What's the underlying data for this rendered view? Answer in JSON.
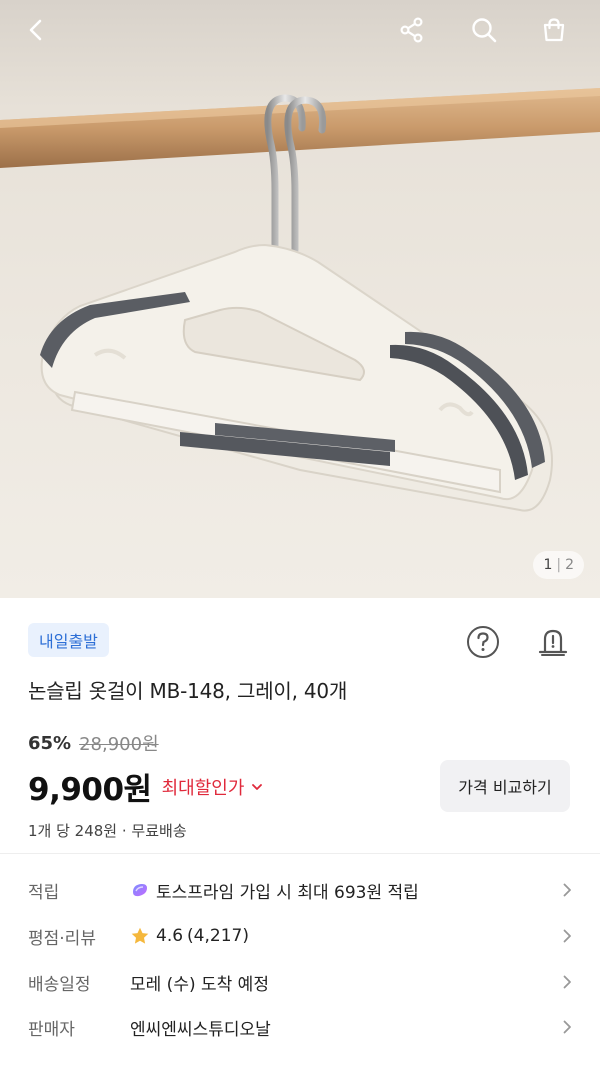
{
  "hero": {
    "image_index": "1",
    "image_total": "2"
  },
  "icons": {
    "back": "chevron-left-icon",
    "share": "share-icon",
    "search": "search-icon",
    "cart": "shopping-bag-icon",
    "help": "question-icon",
    "alert": "alarm-bell-icon",
    "expand": "chevron-down-icon",
    "points": "toss-prime-icon",
    "rating": "star-icon",
    "row_chevron": "chevron-right-icon"
  },
  "product": {
    "badge": "내일출발",
    "title": "논슬립 옷걸이 MB-148, 그레이, 40개",
    "discount_rate": "65%",
    "original_price": "28,900원",
    "price": "9,900원",
    "max_discount_label": "최대할인가",
    "compare_button": "가격 비교하기",
    "unit_info": "1개 당 248원 · 무료배송"
  },
  "info": {
    "points": {
      "label": "적립",
      "value": "토스프라임 가입 시 최대 693원 적립"
    },
    "rating": {
      "label": "평점·리뷰",
      "score": "4.6",
      "count": "(4,217)"
    },
    "delivery": {
      "label": "배송일정",
      "value": "모레 (수) 도착 예정"
    },
    "seller": {
      "label": "판매자",
      "value": "엔씨엔씨스튜디오날"
    }
  },
  "colors": {
    "badge_bg": "#e9f1fd",
    "badge_text": "#2d6fd6",
    "discount_red": "#e0293b",
    "star": "#f5b83d"
  }
}
